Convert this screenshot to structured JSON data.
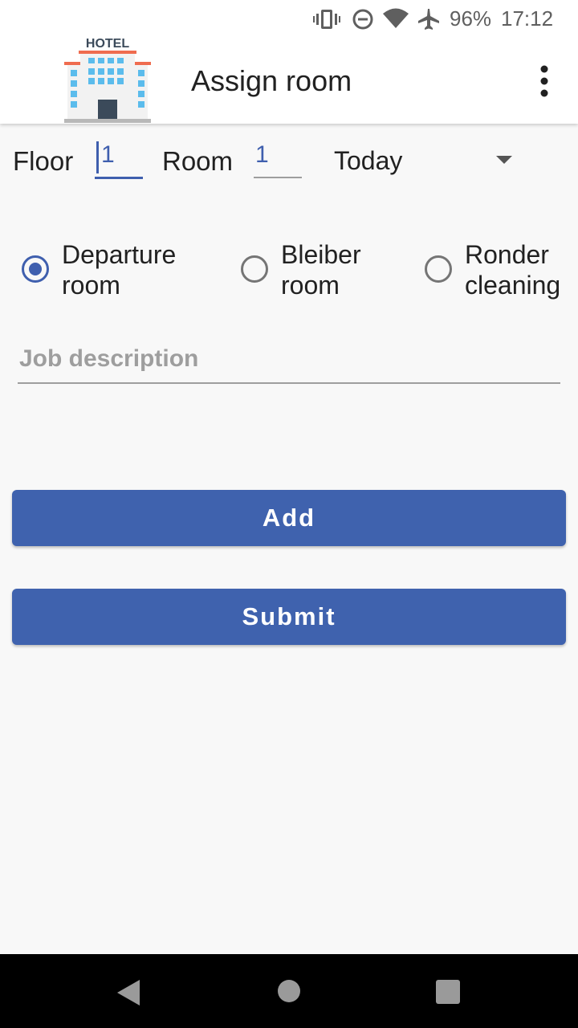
{
  "status_bar": {
    "battery": "96%",
    "time": "17:12",
    "icons": [
      "vibrate-icon",
      "dnd-icon",
      "wifi-icon",
      "airplane-icon"
    ]
  },
  "app_bar": {
    "logo_text": "HOTEL",
    "title": "Assign room",
    "menu_icon": "overflow-menu-icon"
  },
  "form": {
    "floor_label": "Floor",
    "floor_value": "1",
    "room_label": "Room",
    "room_value": "1",
    "day_selected": "Today",
    "job_placeholder": "Job description",
    "job_value": ""
  },
  "radios": [
    {
      "line1": "Departure",
      "line2": "room",
      "checked": true
    },
    {
      "line1": "Bleiber",
      "line2": "room",
      "checked": false
    },
    {
      "line1": "Ronder",
      "line2": "cleaning",
      "checked": false
    }
  ],
  "buttons": {
    "add": "Add",
    "submit": "Submit"
  },
  "colors": {
    "accent": "#3f62ae",
    "text": "#212121",
    "hint": "#9e9e9e",
    "background": "#f8f8f8"
  }
}
